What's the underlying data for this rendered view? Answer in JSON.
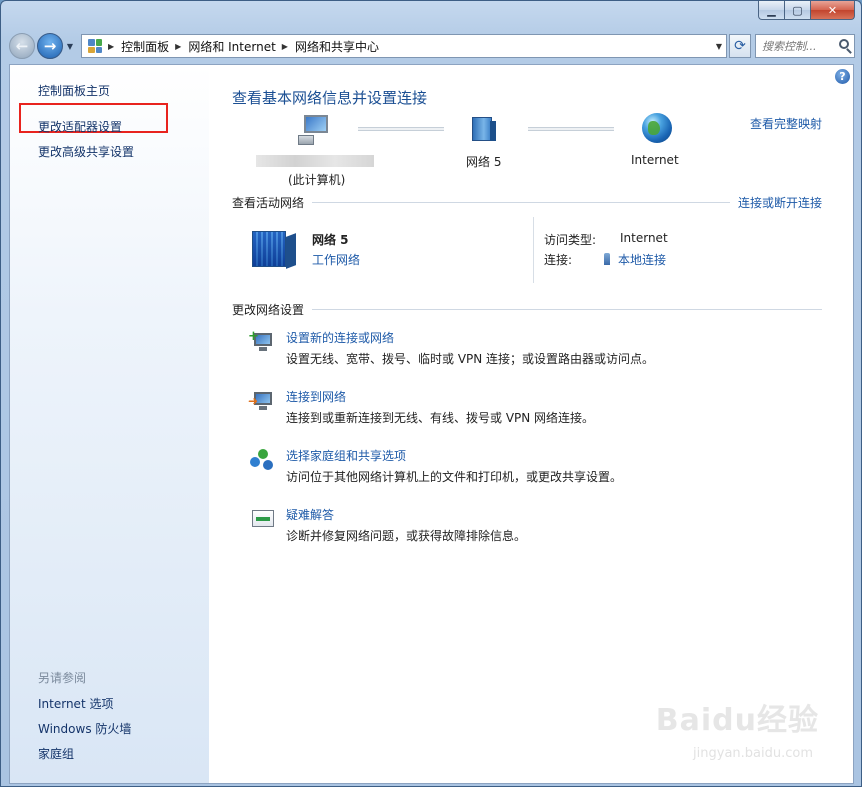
{
  "address": {
    "crumbs": [
      "控制面板",
      "网络和 Internet",
      "网络和共享中心"
    ],
    "search_placeholder": "搜索控制..."
  },
  "sidebar": {
    "items": [
      "控制面板主页",
      "更改适配器设置",
      "更改高级共享设置"
    ],
    "see_also_title": "另请参阅",
    "see_also": [
      "Internet 选项",
      "Windows 防火墙",
      "家庭组"
    ]
  },
  "main": {
    "title": "查看基本网络信息并设置连接",
    "full_map_link": "查看完整映射",
    "map": {
      "computer_label": "(此计算机)",
      "network_label": "网络  5",
      "internet_label": "Internet"
    },
    "active_networks": {
      "heading": "查看活动网络",
      "connect_link": "连接或断开连接",
      "network_name": "网络  5",
      "network_type": "工作网络",
      "access_type_label": "访问类型:",
      "access_type_value": "Internet",
      "connection_label": "连接:",
      "connection_value": "本地连接"
    },
    "change_settings": {
      "heading": "更改网络设置",
      "tasks": [
        {
          "title": "设置新的连接或网络",
          "desc": "设置无线、宽带、拨号、临时或 VPN 连接；或设置路由器或访问点。"
        },
        {
          "title": "连接到网络",
          "desc": "连接到或重新连接到无线、有线、拨号或 VPN 网络连接。"
        },
        {
          "title": "选择家庭组和共享选项",
          "desc": "访问位于其他网络计算机上的文件和打印机，或更改共享设置。"
        },
        {
          "title": "疑难解答",
          "desc": "诊断并修复网络问题，或获得故障排除信息。"
        }
      ]
    }
  },
  "watermark": {
    "brand": "Baidu经验",
    "url": "jingyan.baidu.com"
  },
  "colors": {
    "link": "#1e5aa8",
    "title": "#1b4f93",
    "highlight": "#e8231e"
  }
}
